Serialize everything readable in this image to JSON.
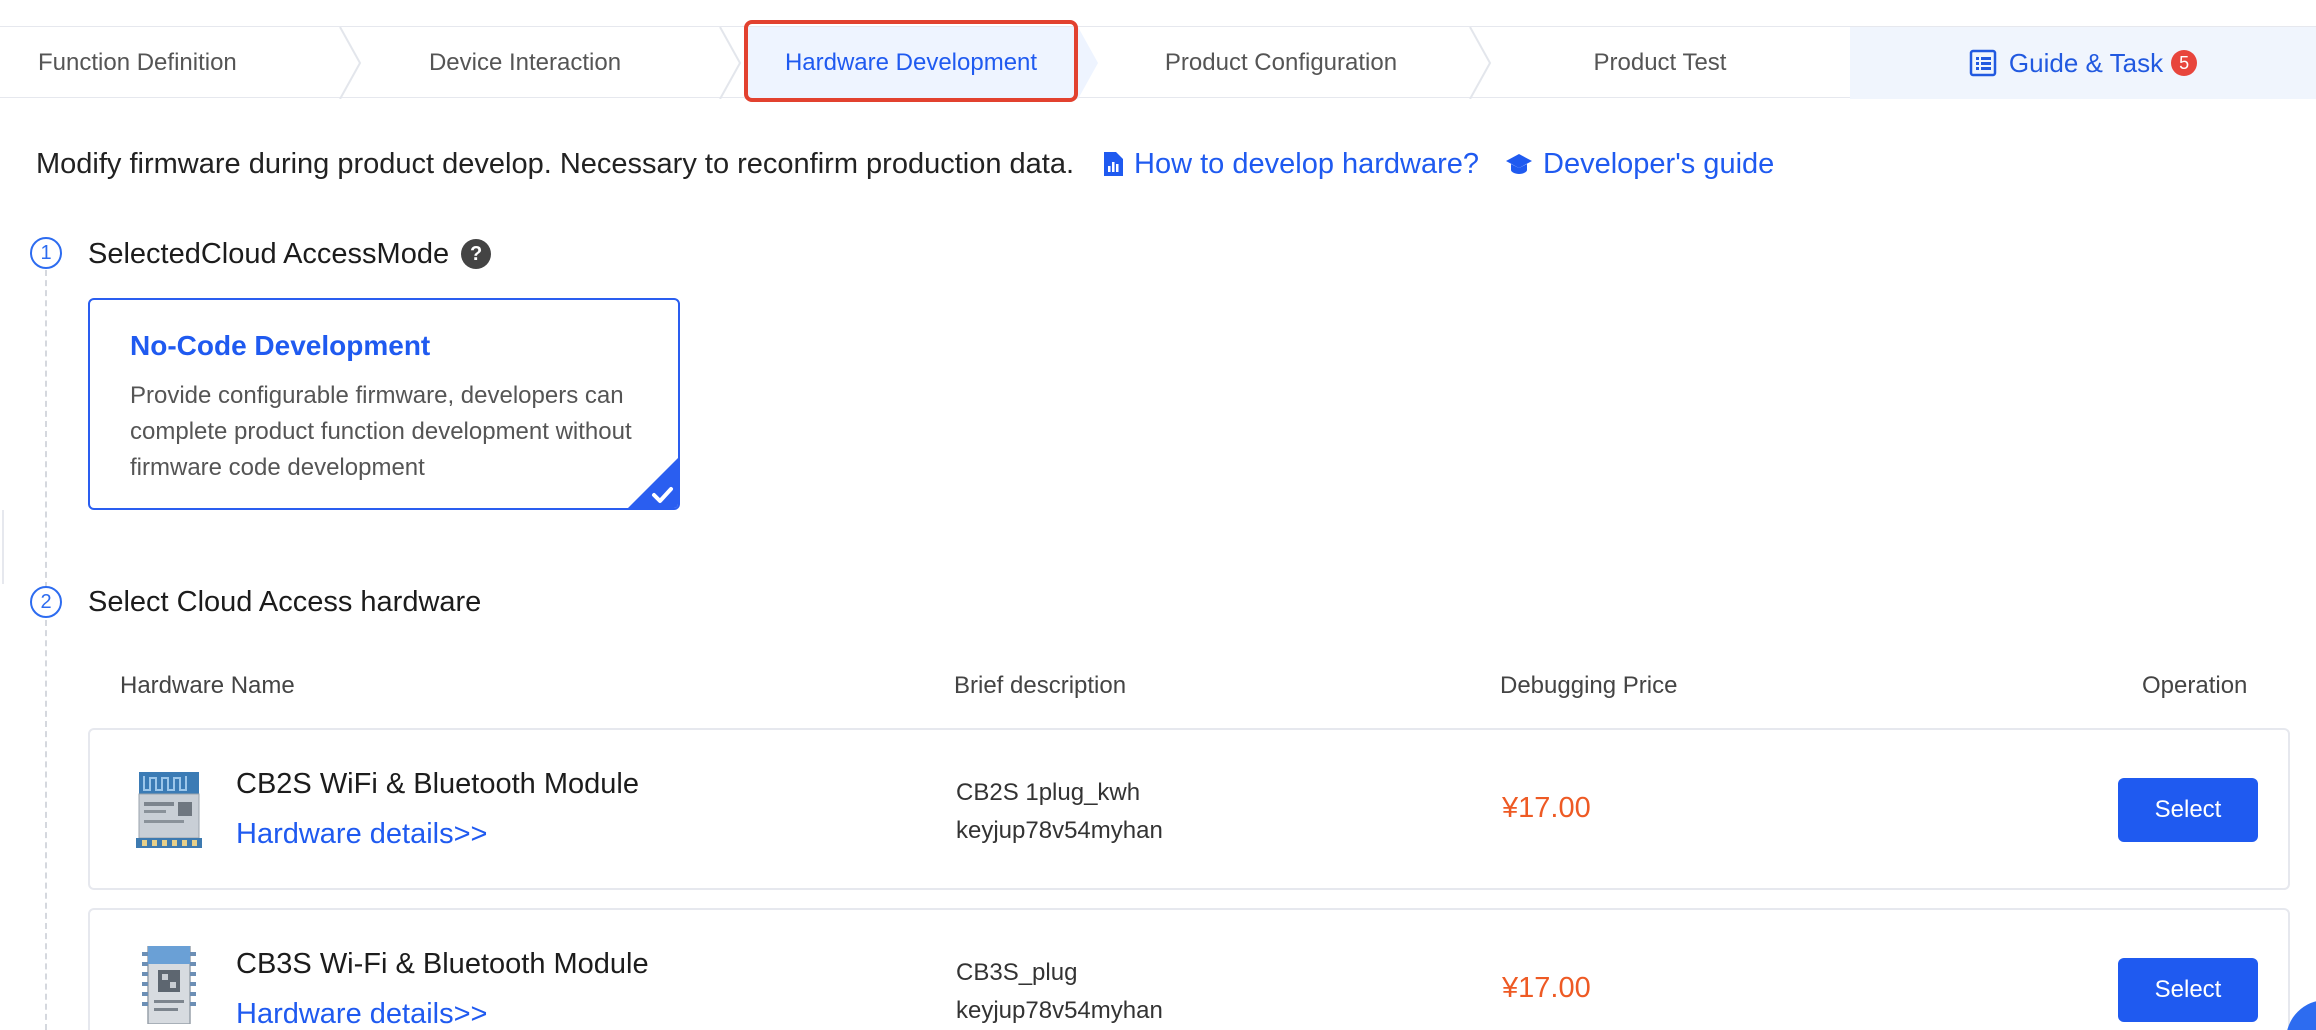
{
  "tabs": [
    {
      "label": "Function Definition"
    },
    {
      "label": "Device Interaction"
    },
    {
      "label": "Hardware Development"
    },
    {
      "label": "Product Configuration"
    },
    {
      "label": "Product Test"
    },
    {
      "label": "Guide & Task",
      "badge": "5"
    }
  ],
  "active_tab": "Hardware Development",
  "intro": {
    "text": "Modify firmware during product develop. Necessary to reconfirm production data.",
    "link_hardware": "How to develop hardware?",
    "link_guide": "Developer's guide"
  },
  "step1": {
    "number": "1",
    "title": "SelectedCloud AccessMode",
    "help": "?",
    "card": {
      "title": "No-Code Development",
      "description": "Provide configurable firmware, developers can complete product function development without firmware code development",
      "selected": true
    }
  },
  "step2": {
    "number": "2",
    "title": "Select Cloud Access hardware"
  },
  "table": {
    "headers": {
      "name": "Hardware Name",
      "description": "Brief description",
      "price": "Debugging Price",
      "operation": "Operation"
    },
    "rows": [
      {
        "name": "CB2S WiFi & Bluetooth Module",
        "details": "Hardware details>>",
        "desc_line1": "CB2S 1plug_kwh",
        "desc_line2": "keyjup78v54myhan",
        "price": "¥17.00",
        "button": "Select"
      },
      {
        "name": "CB3S Wi-Fi & Bluetooth Module",
        "details": "Hardware details>>",
        "desc_line1": "CB3S_plug",
        "desc_line2": "keyjup78v54myhan",
        "price": "¥17.00",
        "button": "Select"
      }
    ]
  },
  "colors": {
    "primary": "#1f5af0",
    "price": "#ee5a24",
    "active_frame": "#e2412f",
    "badge": "#e8453c"
  },
  "icons": {
    "guide": "list-document-icon",
    "hardware_link": "document-chart-icon",
    "guide_link": "graduation-cap-icon",
    "help": "question-circle-icon",
    "check": "checkmark-corner-icon"
  }
}
